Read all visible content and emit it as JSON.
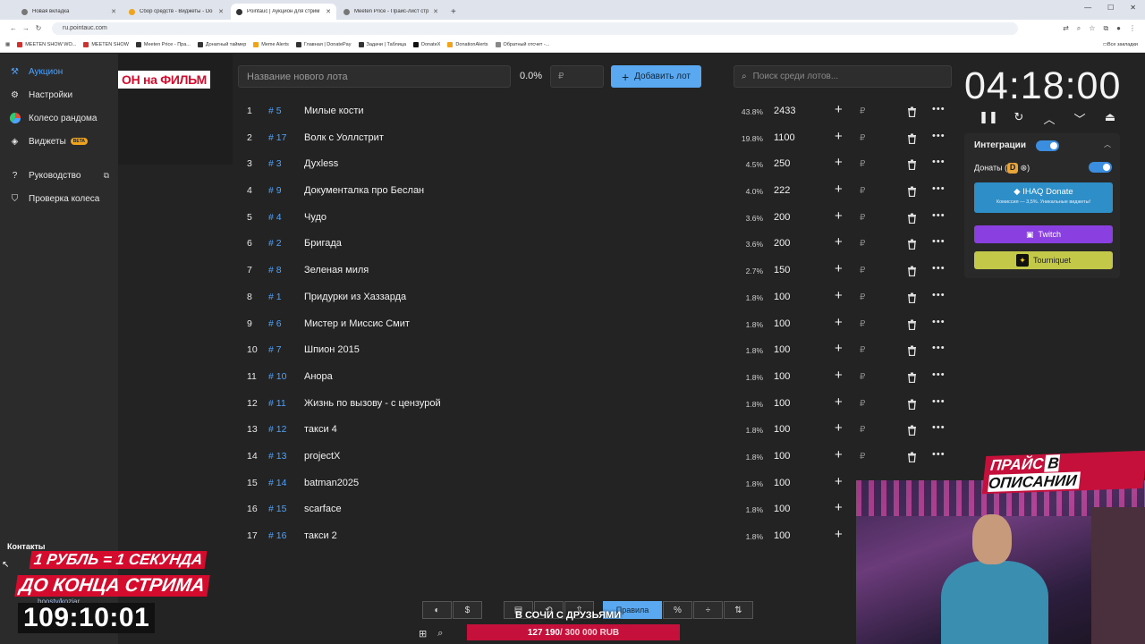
{
  "browser": {
    "tabs": [
      {
        "title": "Новая вкладка",
        "active": false
      },
      {
        "title": "Сбор средств - Виджеты - Do",
        "active": false
      },
      {
        "title": "Pointauc | Аукцион для стрим",
        "active": true
      },
      {
        "title": "Meeten Price - Прайс-лист стр",
        "active": false
      }
    ],
    "url": "ru.pointauc.com",
    "bookmarks": [
      "MEETEN SHOW WO...",
      "MEETEN SHOW",
      "Meeten Price - Пра...",
      "Донатный таймер",
      "Meme Alerts",
      "Главная | DonatePay",
      "Задачи | Таблица",
      "DonateX",
      "DonationAlerts",
      "Обратный отсчет -..."
    ],
    "bookmarks_all": "Все закладки"
  },
  "sidebar": {
    "items": [
      {
        "label": "Аукцион",
        "icon": "gavel-icon",
        "active": true
      },
      {
        "label": "Настройки",
        "icon": "gear-icon",
        "active": false
      },
      {
        "label": "Колесо рандома",
        "icon": "pie-wheel-icon",
        "active": false
      },
      {
        "label": "Виджеты",
        "icon": "layers-icon",
        "active": false,
        "badge": "BETA"
      }
    ],
    "secondary": [
      {
        "label": "Руководство",
        "icon": "help-icon",
        "external": true
      },
      {
        "label": "Проверка колеса",
        "icon": "shield-check-icon",
        "external": false
      }
    ]
  },
  "banner_text": "ОН на ФИЛЬМ",
  "controls": {
    "lot_placeholder": "Название нового лота",
    "percent": "0.0%",
    "amount_placeholder": "₽",
    "add_button": "Добавить лот",
    "search_placeholder": "Поиск среди лотов..."
  },
  "lots": [
    {
      "rank": "1",
      "id": "# 5",
      "name": "Милые кости",
      "pct": "43.8%",
      "amount": "2433"
    },
    {
      "rank": "2",
      "id": "# 17",
      "name": "Волк с Уоллстрит",
      "pct": "19.8%",
      "amount": "1100"
    },
    {
      "rank": "3",
      "id": "# 3",
      "name": "Духless",
      "pct": "4.5%",
      "amount": "250"
    },
    {
      "rank": "4",
      "id": "# 9",
      "name": "Документалка про Беслан",
      "pct": "4.0%",
      "amount": "222"
    },
    {
      "rank": "5",
      "id": "# 4",
      "name": "Чудо",
      "pct": "3.6%",
      "amount": "200"
    },
    {
      "rank": "6",
      "id": "# 2",
      "name": "Бригада",
      "pct": "3.6%",
      "amount": "200"
    },
    {
      "rank": "7",
      "id": "# 8",
      "name": "Зеленая миля",
      "pct": "2.7%",
      "amount": "150"
    },
    {
      "rank": "8",
      "id": "# 1",
      "name": "Придурки из Хаззарда",
      "pct": "1.8%",
      "amount": "100"
    },
    {
      "rank": "9",
      "id": "# 6",
      "name": "Мистер и Миссис Смит",
      "pct": "1.8%",
      "amount": "100"
    },
    {
      "rank": "10",
      "id": "# 7",
      "name": "Шпион 2015",
      "pct": "1.8%",
      "amount": "100"
    },
    {
      "rank": "11",
      "id": "# 10",
      "name": "Анора",
      "pct": "1.8%",
      "amount": "100"
    },
    {
      "rank": "12",
      "id": "# 11",
      "name": "Жизнь по вызову - с цензурой",
      "pct": "1.8%",
      "amount": "100"
    },
    {
      "rank": "13",
      "id": "# 12",
      "name": "такси 4",
      "pct": "1.8%",
      "amount": "100"
    },
    {
      "rank": "14",
      "id": "# 13",
      "name": "projectX",
      "pct": "1.8%",
      "amount": "100"
    },
    {
      "rank": "15",
      "id": "# 14",
      "name": "batman2025",
      "pct": "1.8%",
      "amount": "100"
    },
    {
      "rank": "16",
      "id": "# 15",
      "name": "scarface",
      "pct": "1.8%",
      "amount": "100"
    },
    {
      "rank": "17",
      "id": "# 16",
      "name": "такси 2",
      "pct": "1.8%",
      "amount": "100"
    }
  ],
  "currency_symbol": "₽",
  "timer": {
    "value": "04:18:00"
  },
  "integrations": {
    "title": "Интеграции",
    "enabled": true,
    "donations_label": "Донаты (",
    "donations_suffix": ")",
    "ihaq_title": "IHAQ Donate",
    "ihaq_sub": "Комиссия — 3,5%. Уникальные виджеты!",
    "twitch": "Twitch",
    "tourniquet": "Tourniquet"
  },
  "bottom_toolbar": {
    "rules": "Правила"
  },
  "overlay": {
    "contacts": "Контакты",
    "line1": "1 РУБЛЬ = 1 СЕКУНДА",
    "line2": "ДО КОНЦА СТРИМА",
    "boosty": "boosty/kozjar",
    "countdown": "109:10:01",
    "price_a": "ПРАЙС",
    "price_b": "В ОПИСАНИИ",
    "subtitle": "В СОЧИ С ДРУЗЬЯМИ",
    "goal_current": "127 190",
    "goal_total": " / 300 000 RUB"
  },
  "colors": {
    "accent": "#4ea3ff",
    "button": "#5aa9f0",
    "overlay_red": "#d40b2c",
    "twitch": "#8a3fe0"
  }
}
